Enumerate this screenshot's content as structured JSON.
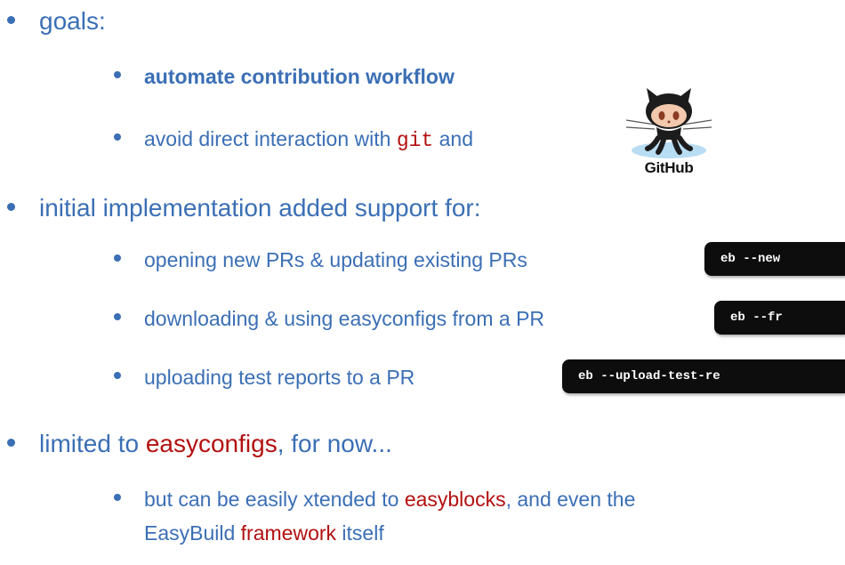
{
  "slide": {
    "goals": {
      "label": "goals:",
      "items": [
        {
          "text": "automate contribution workflow"
        },
        {
          "text_before": "avoid direct interaction with ",
          "code": "git",
          "text_after": " and"
        }
      ]
    },
    "initial": {
      "label": "initial implementation added support for:",
      "items": [
        {
          "text": "opening new PRs & updating existing PRs",
          "command": "eb --new"
        },
        {
          "text": "downloading & using easyconfigs from a PR",
          "command": "eb --fr"
        },
        {
          "text": "uploading test reports to a PR",
          "command": "eb --upload-test-re"
        }
      ]
    },
    "limited": {
      "text_before": "limited to ",
      "highlight": "easyconfigs",
      "text_after": ", for now...",
      "sub": {
        "part1": "but can be easily xtended to ",
        "highlight1": "easyblocks",
        "part2": ", and even the",
        "part3": "EasyBuild ",
        "highlight2": "framework",
        "part4": " itself"
      }
    },
    "logo": {
      "text": "GitHub",
      "icon": "octocat-icon"
    }
  }
}
